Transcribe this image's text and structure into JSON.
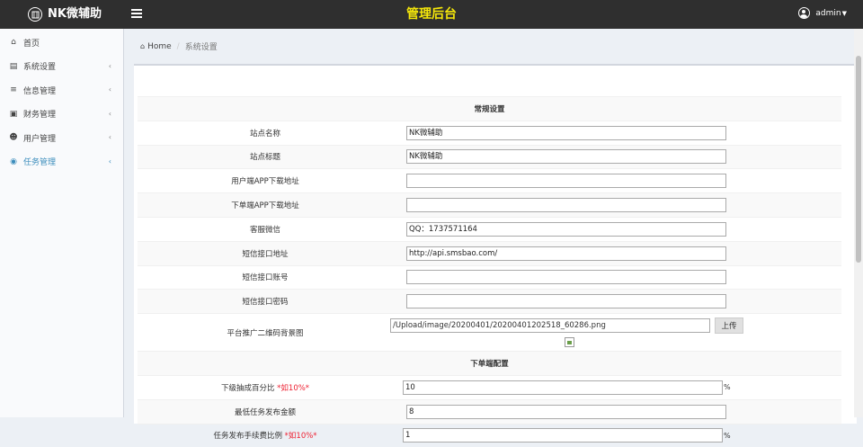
{
  "header": {
    "brand_name": "NK微辅助",
    "title": "管理后台",
    "user": "admin",
    "accent_title_color": "#f5e70a"
  },
  "sidebar": {
    "items": [
      {
        "label": "首页",
        "icon": "home-icon"
      },
      {
        "label": "系统设置",
        "icon": "list-icon"
      },
      {
        "label": "信息管理",
        "icon": "bars-icon"
      },
      {
        "label": "财务管理",
        "icon": "money-icon"
      },
      {
        "label": "用户管理",
        "icon": "users-icon"
      },
      {
        "label": "任务管理",
        "icon": "target-icon",
        "active": true
      }
    ],
    "chevron": "‹",
    "active_color": "#3c8dbc"
  },
  "breadcrumb": {
    "home": "Home",
    "separator": "/",
    "current": "系统设置"
  },
  "form": {
    "section_general": "常规设置",
    "rows": [
      {
        "label": "站点名称",
        "value": ""
      },
      {
        "label": "站点标题",
        "value": ""
      },
      {
        "label": "用户端APP下载地址",
        "value": ""
      },
      {
        "label": "下单端APP下载地址",
        "value": ""
      },
      {
        "label": "客服微信",
        "value": "QQ：1737571164"
      },
      {
        "label": "短信接口地址",
        "value": "http://api.smsbao.com/"
      },
      {
        "label": "短信接口账号",
        "value": ""
      },
      {
        "label": "短信接口密码",
        "value": ""
      }
    ],
    "site_name_value": "NK微辅助",
    "site_title_value": "NK微辅助",
    "bg_image_label": "平台推广二维码背景图",
    "bg_image_value": "/Upload/image/20200401/20200401202518_60286.png",
    "upload_label": "上传",
    "section_order": "下单端配置",
    "commission_label": "下级抽成百分比",
    "commission_hint": "*如10%*",
    "commission_value": "10",
    "commission_unit": "%",
    "min_amount_label": "最低任务发布金额",
    "min_amount_value": "8",
    "partial_label": "任务发布手续费比例",
    "partial_hint": "*如10%*",
    "partial_value": "1",
    "partial_unit": "%"
  }
}
